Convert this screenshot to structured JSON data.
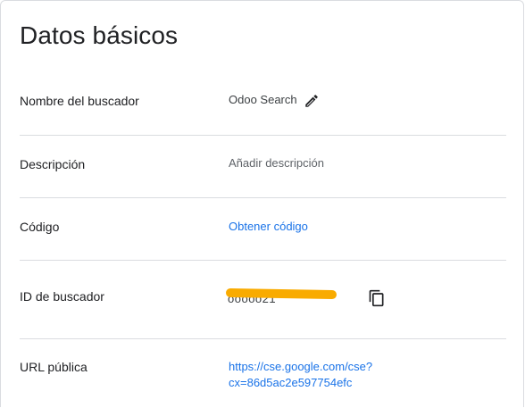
{
  "section": {
    "title": "Datos básicos"
  },
  "rows": {
    "name": {
      "label": "Nombre del buscador",
      "value": "Odoo Search"
    },
    "description": {
      "label": "Descripción",
      "placeholder": "Añadir descripción"
    },
    "code": {
      "label": "Código",
      "link": "Obtener código"
    },
    "engine_id": {
      "label": "ID de buscador",
      "value_visible_fragments": "ooooo21"
    },
    "public_url": {
      "label": "URL pública",
      "url_line1": "https://cse.google.com/cse?",
      "url_line2": "cx=86d5ac2e597754efc"
    }
  },
  "icons": {
    "edit": "pencil-icon",
    "copy": "copy-icon"
  },
  "colors": {
    "link": "#1a73e8",
    "divider": "#dadce0",
    "redaction": "#f9ab00"
  }
}
